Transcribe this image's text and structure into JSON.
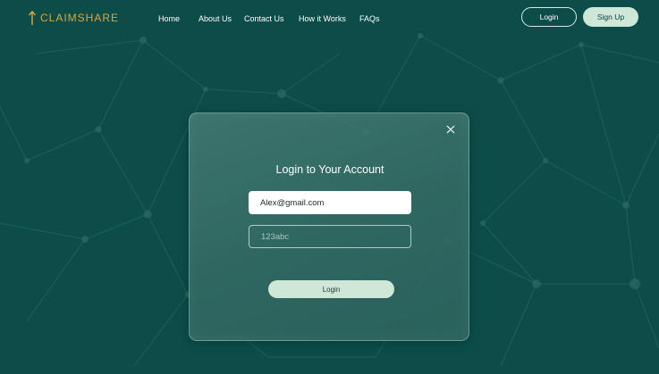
{
  "brand": {
    "name": "CLAIMSHARE",
    "accent_color": "#d9a93c",
    "icon": "up-arrow-icon"
  },
  "nav": {
    "links": [
      "Home",
      "About Us",
      "Contact Us",
      "How it Works",
      "FAQs"
    ],
    "login_label": "Login",
    "signup_label": "Sign Up"
  },
  "colors": {
    "background": "#0c4d4a",
    "button_fill": "#cfe7d6"
  },
  "modal": {
    "title": "Login to Your Account",
    "email_value": "Alex@gmail.com",
    "password_value": "123abc",
    "login_label": "Login",
    "close_icon": "close-icon"
  }
}
